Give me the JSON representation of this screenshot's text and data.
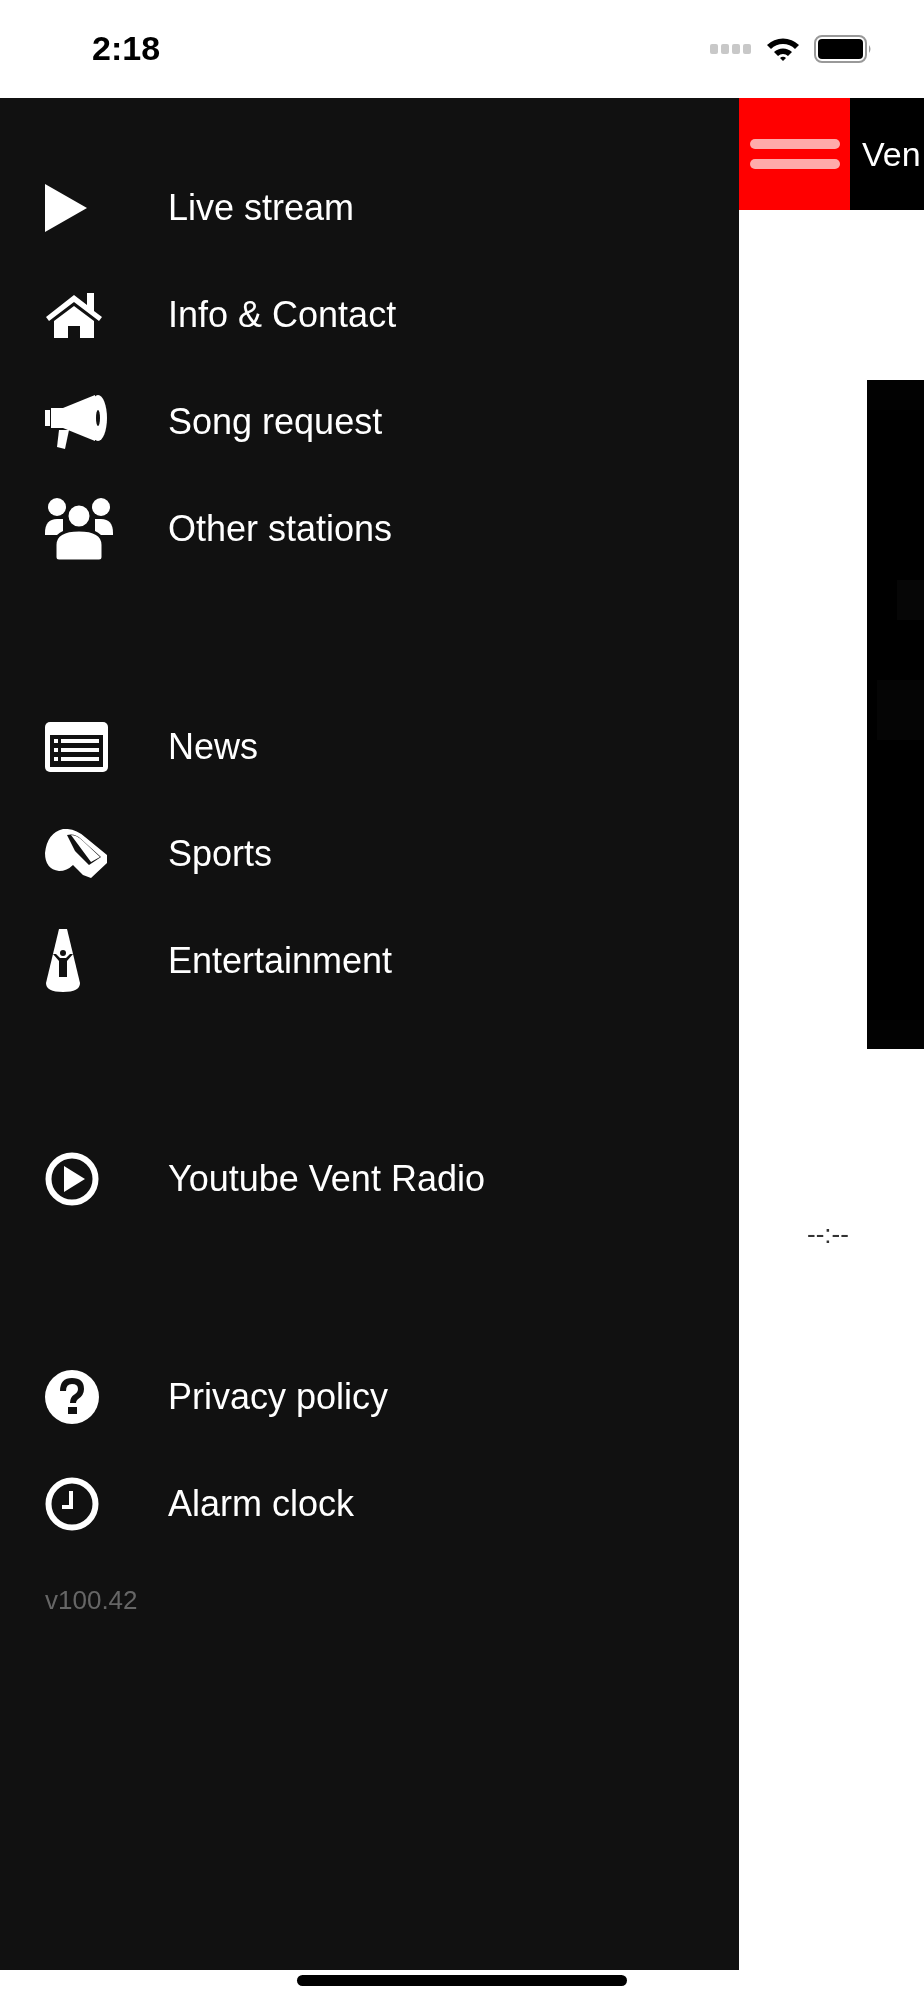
{
  "status_bar": {
    "time": "2:18"
  },
  "drawer": {
    "groups": [
      {
        "items": [
          {
            "label": "Live stream"
          },
          {
            "label": "Info & Contact"
          },
          {
            "label": "Song request"
          },
          {
            "label": "Other stations"
          }
        ]
      },
      {
        "items": [
          {
            "label": "News"
          },
          {
            "label": "Sports"
          },
          {
            "label": "Entertainment"
          }
        ]
      },
      {
        "items": [
          {
            "label": "Youtube Vent Radio"
          }
        ]
      },
      {
        "items": [
          {
            "label": "Privacy policy"
          },
          {
            "label": "Alarm clock"
          }
        ]
      }
    ],
    "version": "v100.42"
  },
  "header": {
    "title": "Ven"
  },
  "player": {
    "time": "--:--"
  }
}
